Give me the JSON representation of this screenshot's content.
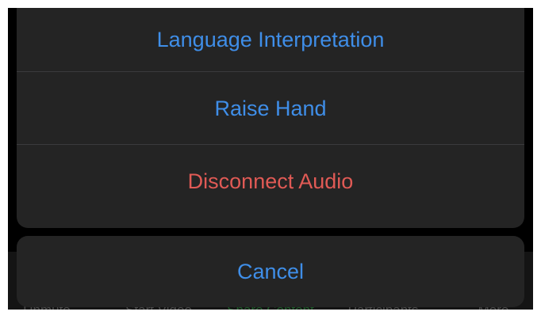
{
  "background_toolbar": {
    "items": [
      {
        "label": "Unmute"
      },
      {
        "label": "Start Video"
      },
      {
        "label": "Share Content"
      },
      {
        "label": "Participants"
      },
      {
        "label": "More"
      }
    ]
  },
  "action_sheet": {
    "actions": [
      {
        "label": "Language Interpretation",
        "color": "#3f8ee8"
      },
      {
        "label": "Raise Hand",
        "color": "#3f8ee8"
      },
      {
        "label": "Disconnect Audio",
        "color": "#e05a55"
      }
    ],
    "cancel_label": "Cancel",
    "cancel_color": "#3f8ee8"
  },
  "colors": {
    "sheet_background": "#242424",
    "backdrop": "#000000",
    "separator": "#3b3b3d"
  }
}
